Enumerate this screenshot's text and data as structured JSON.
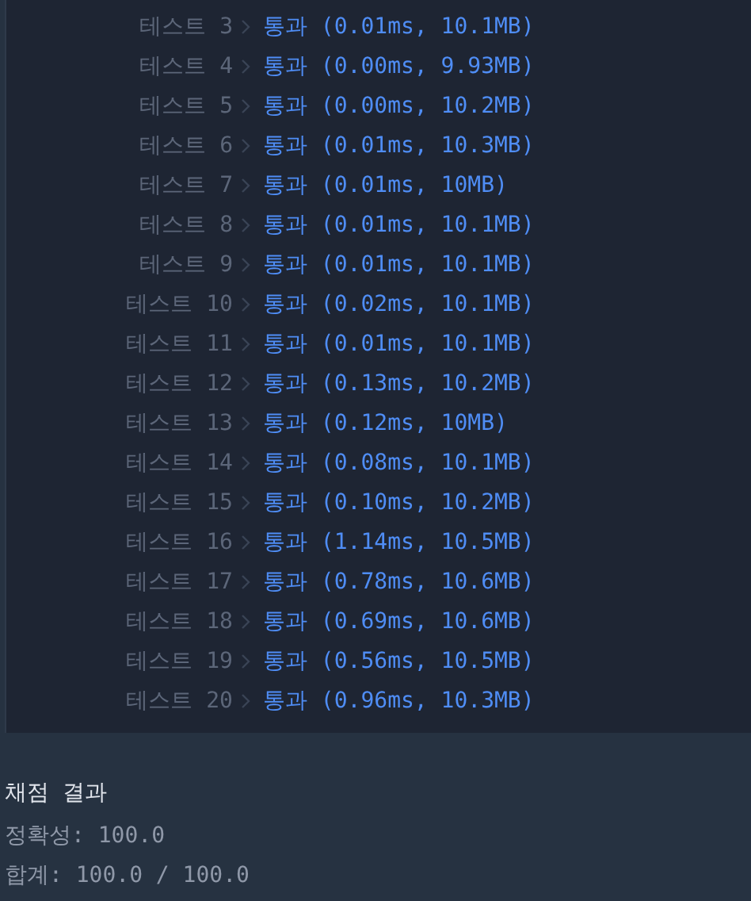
{
  "tests": [
    {
      "label": "테스트 3",
      "result": "통과 (0.01ms, 10.1MB)"
    },
    {
      "label": "테스트 4",
      "result": "통과 (0.00ms, 9.93MB)"
    },
    {
      "label": "테스트 5",
      "result": "통과 (0.00ms, 10.2MB)"
    },
    {
      "label": "테스트 6",
      "result": "통과 (0.01ms, 10.3MB)"
    },
    {
      "label": "테스트 7",
      "result": "통과 (0.01ms, 10MB)"
    },
    {
      "label": "테스트 8",
      "result": "통과 (0.01ms, 10.1MB)"
    },
    {
      "label": "테스트 9",
      "result": "통과 (0.01ms, 10.1MB)"
    },
    {
      "label": "테스트 10",
      "result": "통과 (0.02ms, 10.1MB)"
    },
    {
      "label": "테스트 11",
      "result": "통과 (0.01ms, 10.1MB)"
    },
    {
      "label": "테스트 12",
      "result": "통과 (0.13ms, 10.2MB)"
    },
    {
      "label": "테스트 13",
      "result": "통과 (0.12ms, 10MB)"
    },
    {
      "label": "테스트 14",
      "result": "통과 (0.08ms, 10.1MB)"
    },
    {
      "label": "테스트 15",
      "result": "통과 (0.10ms, 10.2MB)"
    },
    {
      "label": "테스트 16",
      "result": "통과 (1.14ms, 10.5MB)"
    },
    {
      "label": "테스트 17",
      "result": "통과 (0.78ms, 10.6MB)"
    },
    {
      "label": "테스트 18",
      "result": "통과 (0.69ms, 10.6MB)"
    },
    {
      "label": "테스트 19",
      "result": "통과 (0.56ms, 10.5MB)"
    },
    {
      "label": "테스트 20",
      "result": "통과 (0.96ms, 10.3MB)"
    }
  ],
  "summary": {
    "title": "채점 결과",
    "lines": [
      "정확성: 100.0",
      "합계: 100.0 / 100.0"
    ]
  }
}
